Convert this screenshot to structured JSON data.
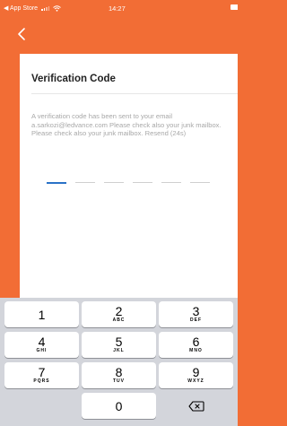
{
  "status_bar": {
    "carrier_back": "◀ App Store",
    "time": "14:27"
  },
  "nav": {
    "back_icon": "chevron-left-icon"
  },
  "verification": {
    "title": "Verification Code",
    "message": "A verification code has been sent to your email a.sarkozi@ledvance.com Please check also your junk mailbox.  Please check also your junk mailbox. Resend (24s)",
    "code_length": 6
  },
  "keypad": {
    "keys": [
      {
        "num": "1",
        "letters": ""
      },
      {
        "num": "2",
        "letters": "ABC"
      },
      {
        "num": "3",
        "letters": "DEF"
      },
      {
        "num": "4",
        "letters": "GHI"
      },
      {
        "num": "5",
        "letters": "JKL"
      },
      {
        "num": "6",
        "letters": "MNO"
      },
      {
        "num": "7",
        "letters": "PQRS"
      },
      {
        "num": "8",
        "letters": "TUV"
      },
      {
        "num": "9",
        "letters": "WXYZ"
      },
      {
        "num": "0",
        "letters": ""
      }
    ],
    "delete_icon": "backspace-icon"
  },
  "colors": {
    "accent": "#f26d35",
    "active_slot": "#2a72c7"
  }
}
